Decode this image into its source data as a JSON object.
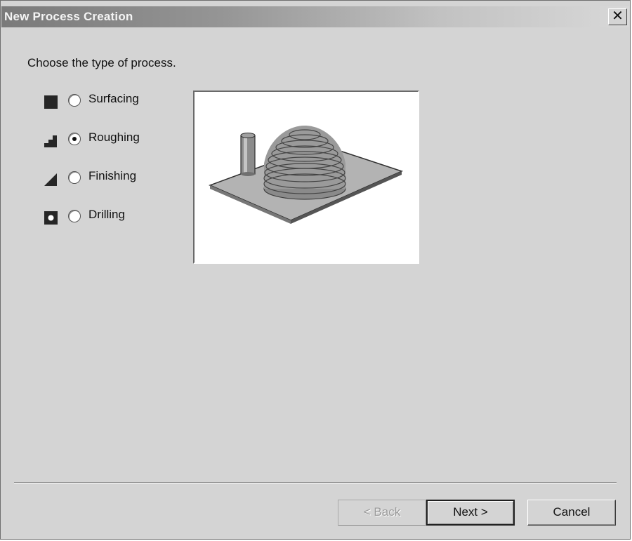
{
  "window": {
    "title": "New Process Creation",
    "close_glyph": "✕"
  },
  "prompt": "Choose the type of process.",
  "options": [
    {
      "label": "Surfacing",
      "icon": "surfacing-icon",
      "selected": false
    },
    {
      "label": "Roughing",
      "icon": "roughing-icon",
      "selected": true
    },
    {
      "label": "Finishing",
      "icon": "finishing-icon",
      "selected": false
    },
    {
      "label": "Drilling",
      "icon": "drilling-icon",
      "selected": false
    }
  ],
  "preview": {
    "image": "roughing-preview-illustration"
  },
  "buttons": {
    "back": "< Back",
    "next": "Next >",
    "cancel": "Cancel",
    "back_enabled": false
  }
}
